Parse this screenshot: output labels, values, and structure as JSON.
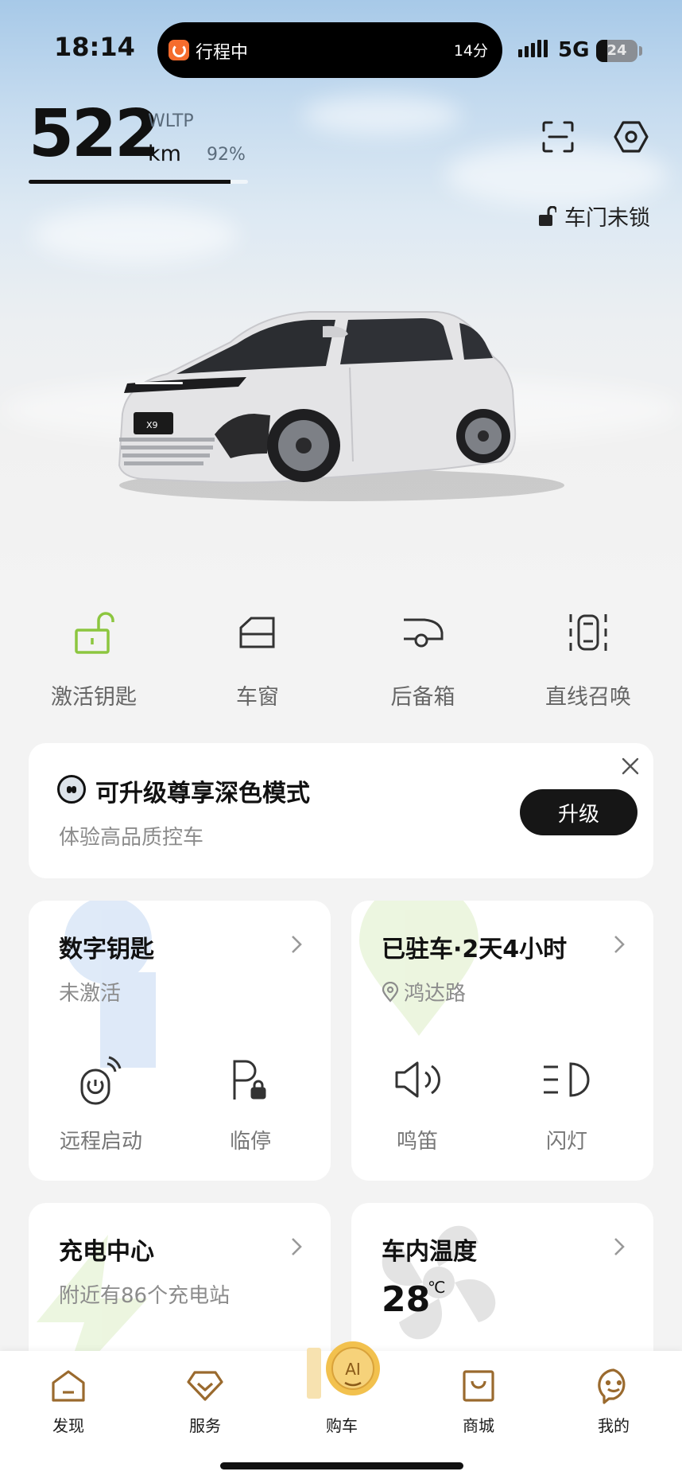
{
  "status_bar": {
    "time": "18:14",
    "live_activity_label": "行程中",
    "live_activity_minutes": "14分",
    "network": "5G",
    "battery_level": "24"
  },
  "range": {
    "value": "522",
    "standard": "WLTP",
    "unit": "km",
    "percent": "92%",
    "percent_fraction": 0.92
  },
  "header_icons": [
    "scan-icon",
    "settings-icon"
  ],
  "door_status": "车门未锁",
  "quick_controls": [
    {
      "label": "激活钥匙",
      "icon": "unlock-icon",
      "color": "#8cc63f"
    },
    {
      "label": "车窗",
      "icon": "window-icon",
      "color": "#333333"
    },
    {
      "label": "后备箱",
      "icon": "trunk-icon",
      "color": "#333333"
    },
    {
      "label": "直线召唤",
      "icon": "summon-icon",
      "color": "#333333"
    }
  ],
  "promo": {
    "title": "可升级尊享深色模式",
    "subtitle": "体验高品质控车",
    "button": "升级"
  },
  "digital_key": {
    "title": "数字钥匙",
    "status": "未激活",
    "actions": [
      "远程启动",
      "临停"
    ]
  },
  "parking": {
    "title": "已驻车·2天4小时",
    "location": "鸿达路",
    "actions": [
      "鸣笛",
      "闪灯"
    ]
  },
  "charging": {
    "title": "充电中心",
    "subtitle": "附近有86个充电站"
  },
  "cabin_temp": {
    "title": "车内温度",
    "value": "28",
    "unit": "℃"
  },
  "tabbar": {
    "items": [
      "发现",
      "服务",
      "购车",
      "商城",
      "我的"
    ],
    "ai_label": "AI"
  },
  "colors": {
    "accent_green": "#8cc63f",
    "tab_brown": "#9a6a2e",
    "ai_gold": "#f2c14e"
  }
}
